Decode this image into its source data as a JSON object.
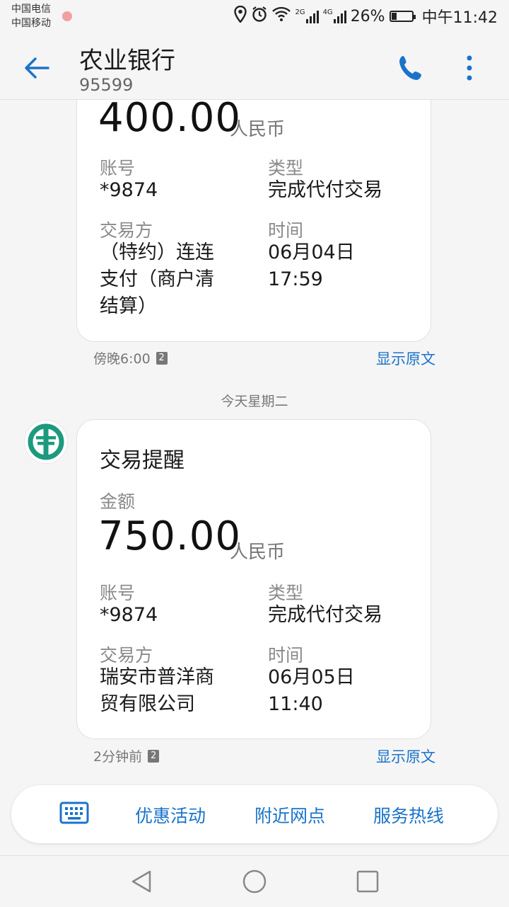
{
  "status_bar": {
    "carrier1": "中国电信",
    "carrier2": "中国移动",
    "network1": "2G",
    "network2": "4G",
    "battery": "26%",
    "battery_level": 0.26,
    "time": "中午11:42"
  },
  "header": {
    "title": "农业银行",
    "subtitle": "95599"
  },
  "messages": [
    {
      "amount": "400.00",
      "currency": "人民币",
      "account_label": "账号",
      "account": "*9874",
      "type_label": "类型",
      "type": "完成代付交易",
      "party_label": "交易方",
      "party_lines": [
        "（特约）连连",
        "支付（商户清",
        "结算）"
      ],
      "time_label": "时间",
      "time_lines": [
        "06月04日",
        "17:59"
      ],
      "meta_time": "傍晚6:00",
      "sim": "2",
      "show_original": "显示原文"
    },
    {
      "day_separator": "今天星期二",
      "title": "交易提醒",
      "amount_label": "金额",
      "amount": "750.00",
      "currency": "人民币",
      "account_label": "账号",
      "account": "*9874",
      "type_label": "类型",
      "type": "完成代付交易",
      "party_label": "交易方",
      "party_lines": [
        "瑞安市普洋商",
        "贸有限公司"
      ],
      "time_label": "时间",
      "time_lines": [
        "06月05日",
        "11:40"
      ],
      "meta_time": "2分钟前",
      "sim": "2",
      "show_original": "显示原文"
    }
  ],
  "bottom_menu": {
    "items": [
      "优惠活动",
      "附近网点",
      "服务热线"
    ]
  },
  "icons": {
    "back": "back-arrow-icon",
    "call": "phone-icon",
    "more": "more-vertical-icon",
    "keyboard": "keyboard-icon",
    "avatar": "abc-bank-logo-icon"
  },
  "colors": {
    "accent": "#1a73c9",
    "bank_green": "#1d9a7e"
  }
}
